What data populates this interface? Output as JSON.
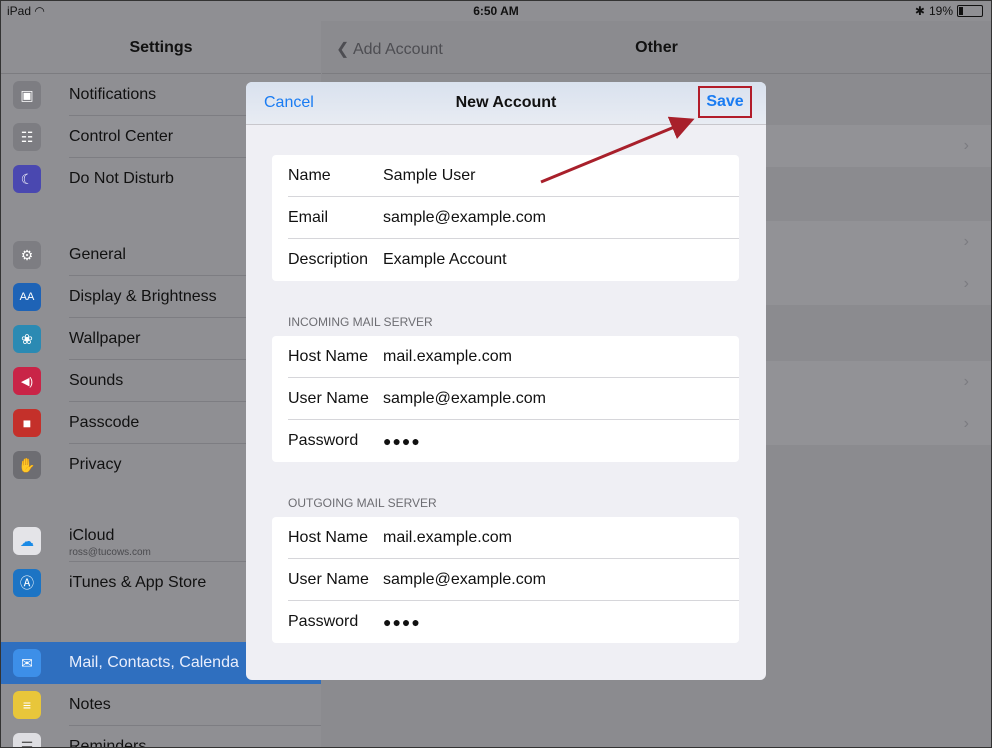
{
  "status_bar": {
    "device": "iPad",
    "time": "6:50 AM",
    "battery": "19%",
    "battery_level_percent": 19
  },
  "sidebar": {
    "title": "Settings",
    "items": [
      {
        "label": "Notifications",
        "icon": "notifications-icon",
        "color": "#8e8e93"
      },
      {
        "label": "Control Center",
        "icon": "control-center-icon",
        "color": "#8e8e93"
      },
      {
        "label": "Do Not Disturb",
        "icon": "moon-icon",
        "color": "#5856d6"
      },
      {
        "label": "General",
        "icon": "gear-icon",
        "color": "#8e8e93"
      },
      {
        "label": "Display & Brightness",
        "icon": "display-icon",
        "color": "#007aff"
      },
      {
        "label": "Wallpaper",
        "icon": "wallpaper-icon",
        "color": "#34aadc"
      },
      {
        "label": "Sounds",
        "icon": "speaker-icon",
        "color": "#ff2d55"
      },
      {
        "label": "Passcode",
        "icon": "lock-icon",
        "color": "#ff3b30"
      },
      {
        "label": "Privacy",
        "icon": "hand-icon",
        "color": "#8e8e93"
      },
      {
        "label": "iCloud",
        "sublabel": "ross@tucows.com",
        "icon": "icloud-icon",
        "color": "#1a8ae6"
      },
      {
        "label": "iTunes & App Store",
        "icon": "app-store-icon",
        "color": "#1a8ae6"
      },
      {
        "label": "Mail, Contacts, Calenda",
        "icon": "mail-icon",
        "color": "#1a7cf2"
      },
      {
        "label": "Notes",
        "icon": "notes-icon",
        "color": "#ffcc00"
      },
      {
        "label": "Reminders",
        "icon": "reminders-icon",
        "color": "#ffffff"
      }
    ]
  },
  "detail": {
    "back_label": "Add Account",
    "title": "Other"
  },
  "modal": {
    "cancel_label": "Cancel",
    "title": "New Account",
    "save_label": "Save",
    "account": [
      {
        "label": "Name",
        "value": "Sample User"
      },
      {
        "label": "Email",
        "value": "sample@example.com"
      },
      {
        "label": "Description",
        "value": "Example Account"
      }
    ],
    "incoming": {
      "title": "INCOMING MAIL SERVER",
      "fields": [
        {
          "label": "Host Name",
          "value": "mail.example.com"
        },
        {
          "label": "User Name",
          "value": "sample@example.com"
        },
        {
          "label": "Password",
          "value": "●●●●"
        }
      ]
    },
    "outgoing": {
      "title": "OUTGOING MAIL SERVER",
      "fields": [
        {
          "label": "Host Name",
          "value": "mail.example.com"
        },
        {
          "label": "User Name",
          "value": "sample@example.com"
        },
        {
          "label": "Password",
          "value": "●●●●"
        }
      ]
    }
  },
  "colors": {
    "accent": "#1a7cf2",
    "highlight": "#b21c2a",
    "selected": "#2f6fbf"
  }
}
